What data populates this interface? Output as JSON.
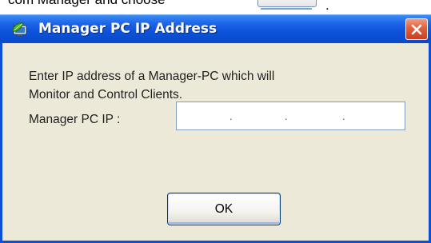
{
  "background_text": "com Manager and choose",
  "background_trailing": ".",
  "dialog": {
    "title": "Manager PC IP Address",
    "prompt_line1": "Enter IP address of a Manager-PC which will",
    "prompt_line2": "Monitor and Control Clients.",
    "ip_label": "Manager PC IP :",
    "ip_value": "",
    "ip_separator": ".",
    "ok_label": "OK"
  },
  "colors": {
    "titlebar": "#0a52da",
    "client": "#ece9d8",
    "close": "#e0603c"
  },
  "icons": {
    "app": "green-leaf-computer-icon",
    "close": "close-x-icon"
  }
}
